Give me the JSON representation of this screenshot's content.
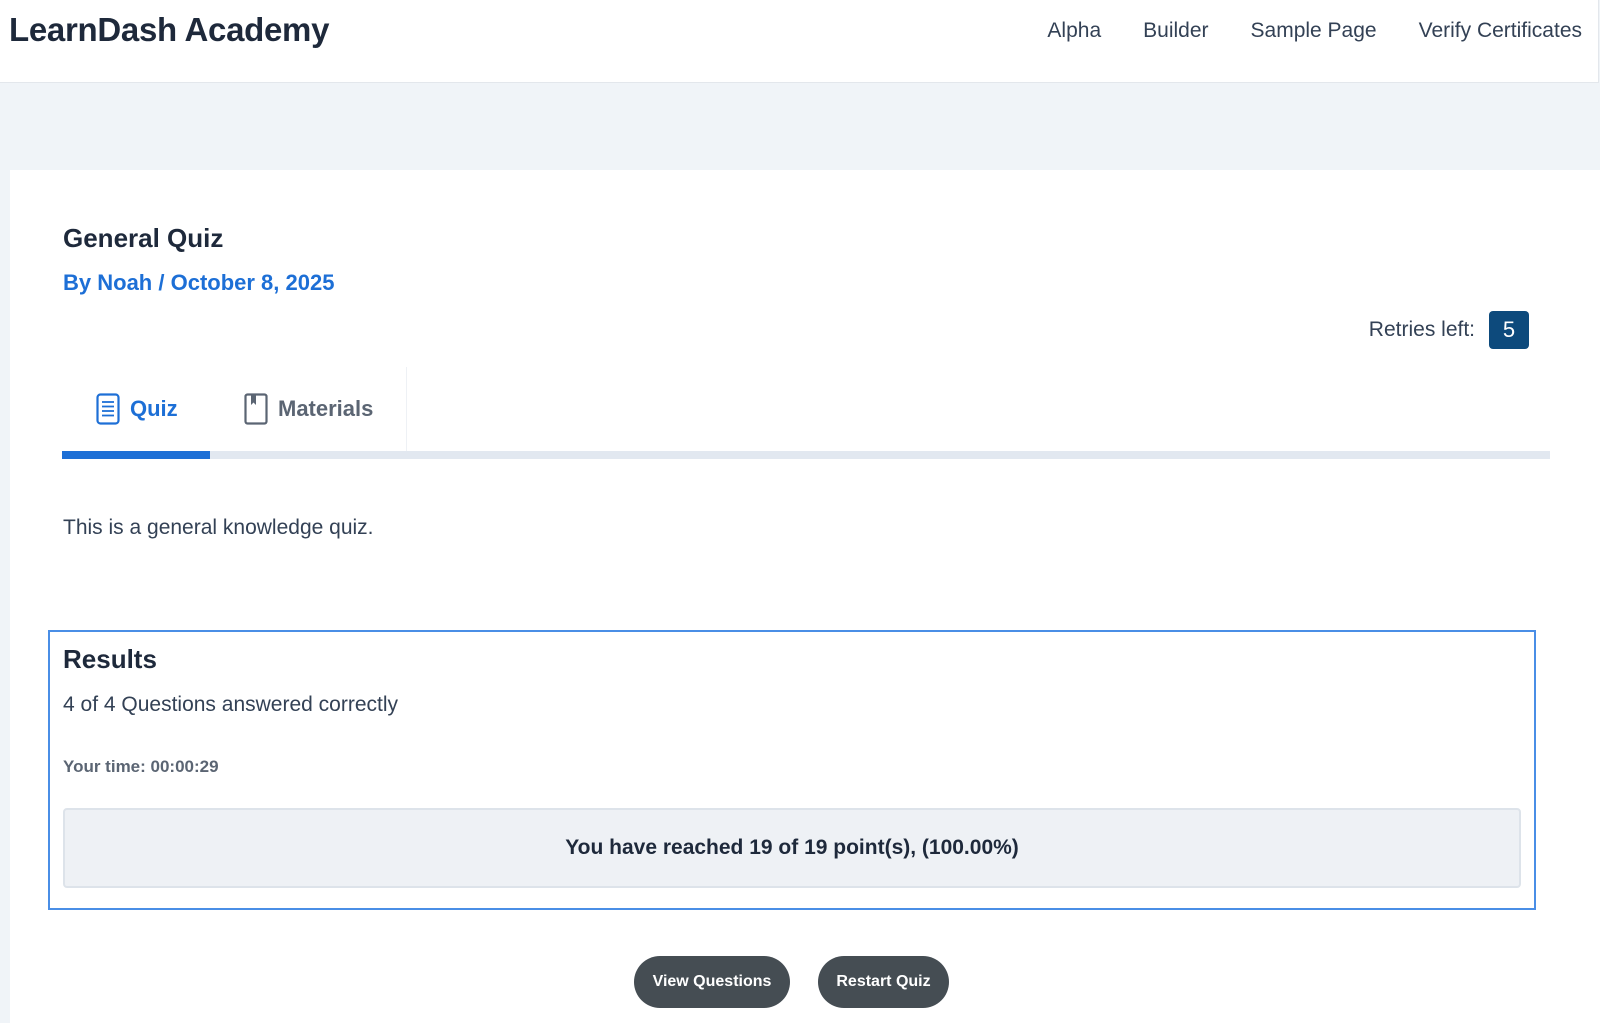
{
  "site": {
    "title": "LearnDash Academy"
  },
  "nav": {
    "items": [
      {
        "label": "Alpha"
      },
      {
        "label": "Builder"
      },
      {
        "label": "Sample Page"
      },
      {
        "label": "Verify Certificates"
      }
    ]
  },
  "quiz": {
    "title": "General Quiz",
    "meta": {
      "prefix": "By ",
      "author": "Noah",
      "separator": " / ",
      "date": "October 8, 2025"
    },
    "retries": {
      "label": "Retries left:",
      "count": "5"
    },
    "tabs": [
      {
        "label": "Quiz",
        "icon": "document-icon",
        "active": true
      },
      {
        "label": "Materials",
        "icon": "bookmark-book-icon",
        "active": false
      }
    ],
    "description": "This is a general knowledge quiz."
  },
  "results": {
    "heading": "Results",
    "correct": "4 of 4 Questions answered correctly",
    "time": "Your time: 00:00:29",
    "points": "You have reached 19 of 19 point(s), (100.00%)"
  },
  "actions": {
    "view_questions": "View Questions",
    "restart_quiz": "Restart Quiz"
  },
  "colors": {
    "accent": "#1d6fd6",
    "badge": "#0d4a7c",
    "results_border": "#4a8ee6",
    "button": "#454d53"
  }
}
